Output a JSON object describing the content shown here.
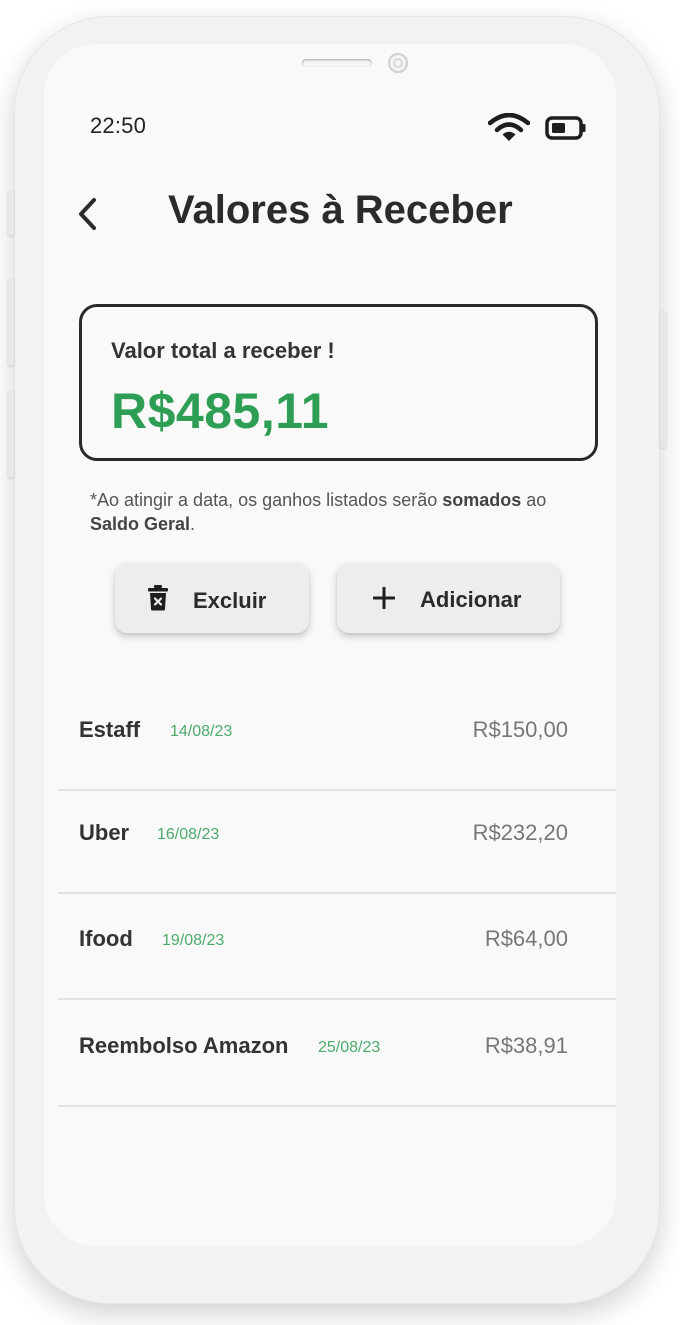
{
  "status": {
    "time": "22:50"
  },
  "header": {
    "title": "Valores à Receber"
  },
  "summary": {
    "label": "Valor total a receber !",
    "value": "R$485,11"
  },
  "note": {
    "prefix": "*Ao atingir a data, os ganhos listados serão ",
    "bold1": "somados",
    "middle": " ao ",
    "bold2": "Saldo Geral",
    "suffix": "."
  },
  "actions": {
    "delete_label": "Excluir",
    "add_label": "Adicionar"
  },
  "entries": [
    {
      "name": "Estaff",
      "date": "14/08/23",
      "amount": "R$150,00"
    },
    {
      "name": "Uber",
      "date": "16/08/23",
      "amount": "R$232,20"
    },
    {
      "name": "Ifood",
      "date": "19/08/23",
      "amount": "R$64,00"
    },
    {
      "name": "Reembolso Amazon",
      "date": "25/08/23",
      "amount": "R$38,91"
    }
  ],
  "colors": {
    "accent_green": "#2e9e54",
    "date_green": "#4daa6c",
    "text_dark": "#2b2b2b"
  },
  "icons": [
    "back-icon",
    "wifi-icon",
    "battery-icon",
    "trash-icon",
    "plus-icon"
  ]
}
